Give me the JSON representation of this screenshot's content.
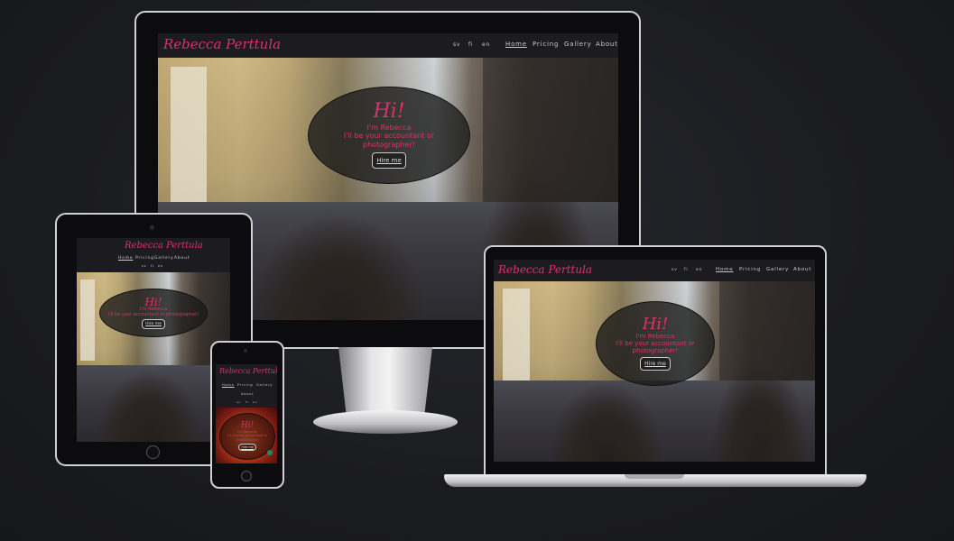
{
  "site": {
    "logo": "Rebecca Perttula",
    "lang": [
      "sv",
      "fi",
      "en"
    ],
    "nav": [
      "Home",
      "Pricing",
      "Gallery",
      "About"
    ],
    "hero": {
      "greeting": "Hi!",
      "line1": "I'm Rebecca",
      "line2": "I'll be your accountant or photographer!",
      "cta": "Hire me"
    }
  },
  "colors": {
    "accent": "#d6336c",
    "nav_bg": "#1c1c20",
    "background": "#1b1c20"
  },
  "devices": [
    "desktop-monitor",
    "tablet",
    "laptop",
    "phone"
  ]
}
